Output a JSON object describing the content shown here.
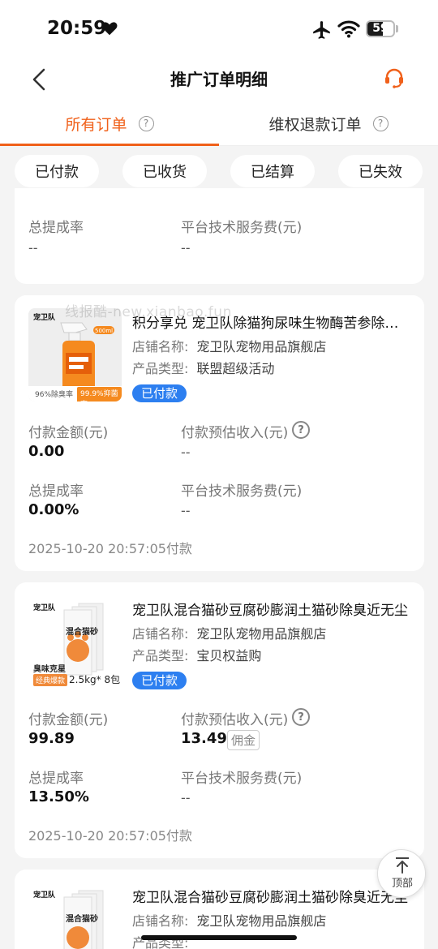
{
  "status_bar": {
    "time": "20:59",
    "battery": "59",
    "battery_level": 0.59
  },
  "nav": {
    "title": "推广订单明细"
  },
  "tabs": [
    {
      "label": "所有订单",
      "active": true
    },
    {
      "label": "维权退款订单",
      "active": false
    }
  ],
  "filters": [
    "已付款",
    "已收货",
    "已结算",
    "已失效"
  ],
  "labels": {
    "payment_amount": "付款金额(元)",
    "estimated_income": "付款预估收入(元)",
    "commission_rate": "总提成率",
    "platform_fee": "平台技术服务费(元)",
    "store_name": "店铺名称:",
    "product_type": "产品类型:",
    "commission_tag": "佣金"
  },
  "watermark": "线报酷-new.xianbao.fun",
  "partial_card": {
    "commission_rate": "--",
    "platform_fee": "--"
  },
  "orders": [
    {
      "title": "积分享兑 宠卫队除猫狗尿味生物酶苦参除臭剂",
      "store": "宠卫队宠物用品旗舰店",
      "type": "联盟超级活动",
      "status": "已付款",
      "payment_amount": "0.00",
      "estimated_income": "--",
      "commission_rate": "0.00%",
      "platform_fee": "--",
      "time": "2025-10-20 20:57:05付款",
      "thumb": {
        "brand": "宠卫队",
        "volume": "500ml",
        "badge_left": "96%除臭率",
        "badge_right": "99.9%抑菌率"
      }
    },
    {
      "title": "宠卫队混合猫砂豆腐砂膨润土猫砂除臭近无尘",
      "store": "宠卫队宠物用品旗舰店",
      "type": "宝贝权益购",
      "status": "已付款",
      "payment_amount": "99.89",
      "estimated_income": "13.49",
      "commission_rate": "13.50%",
      "platform_fee": "--",
      "time": "2025-10-20 20:57:05付款",
      "thumb": {
        "brand": "宠卫队",
        "product": "混合猫砂",
        "tag1": "臭味克星",
        "tag2": "经典爆款",
        "spec": "2.5kg* 8包"
      }
    },
    {
      "title": "宠卫队混合猫砂豆腐砂膨润土猫砂除臭近无尘",
      "store": "宠卫队宠物用品旗舰店",
      "type": "产品类型:",
      "thumb": {
        "brand": "宠卫队",
        "product": "混合猫砂"
      }
    }
  ],
  "back_to_top": "顶部",
  "colors": {
    "accent": "#f0601a",
    "status_blue": "#2d7ff0",
    "background": "#f4f4f4"
  }
}
